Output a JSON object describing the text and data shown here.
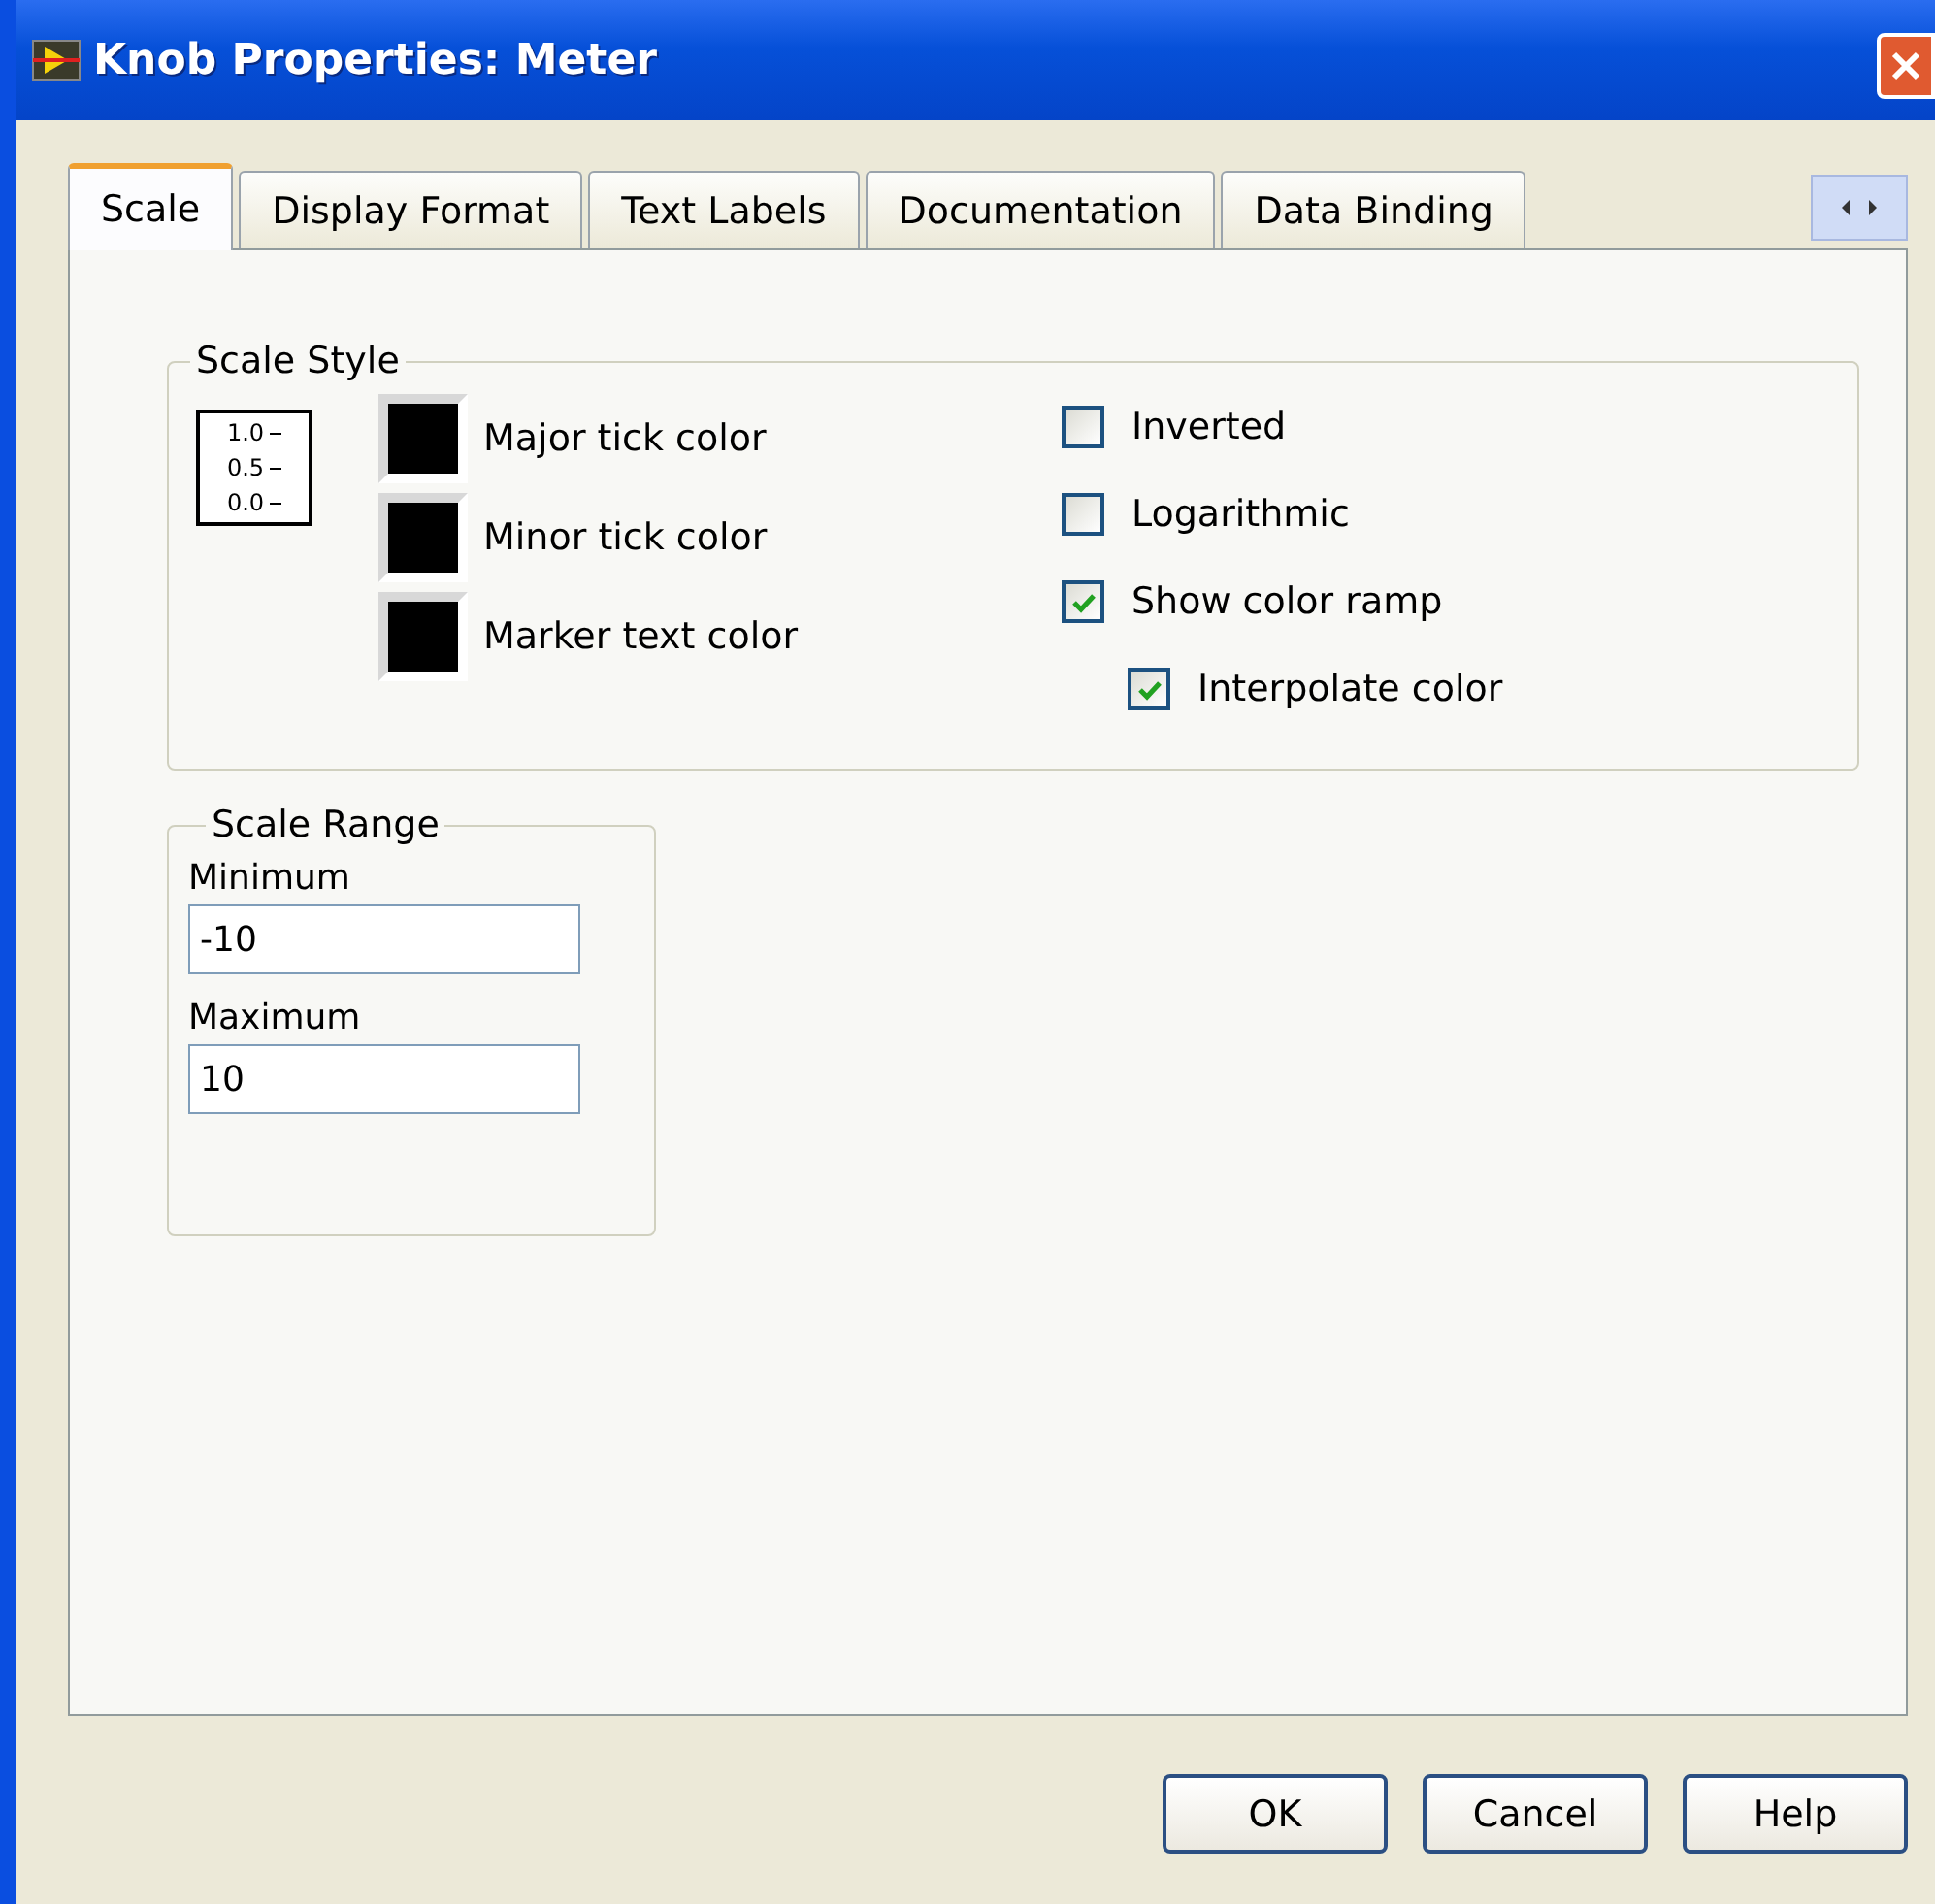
{
  "window": {
    "title": "Knob Properties: Meter"
  },
  "tabs": [
    {
      "label": "Scale",
      "selected": true
    },
    {
      "label": "Display Format",
      "selected": false
    },
    {
      "label": "Text Labels",
      "selected": false
    },
    {
      "label": "Documentation",
      "selected": false
    },
    {
      "label": "Data Binding",
      "selected": false
    }
  ],
  "scale_style": {
    "title": "Scale Style",
    "preview_labels": [
      "1.0",
      "0.5",
      "0.0"
    ],
    "colors": [
      {
        "label": "Major tick color",
        "color": "#000000"
      },
      {
        "label": "Minor tick color",
        "color": "#000000"
      },
      {
        "label": "Marker text color",
        "color": "#000000"
      }
    ],
    "options": [
      {
        "label": "Inverted",
        "checked": false
      },
      {
        "label": "Logarithmic",
        "checked": false
      },
      {
        "label": "Show color ramp",
        "checked": true,
        "children": [
          {
            "label": "Interpolate color",
            "checked": true
          }
        ]
      }
    ]
  },
  "scale_range": {
    "title": "Scale Range",
    "fields": [
      {
        "label": "Minimum",
        "value": "-10"
      },
      {
        "label": "Maximum",
        "value": "10"
      }
    ]
  },
  "buttons": [
    "OK",
    "Cancel",
    "Help"
  ]
}
